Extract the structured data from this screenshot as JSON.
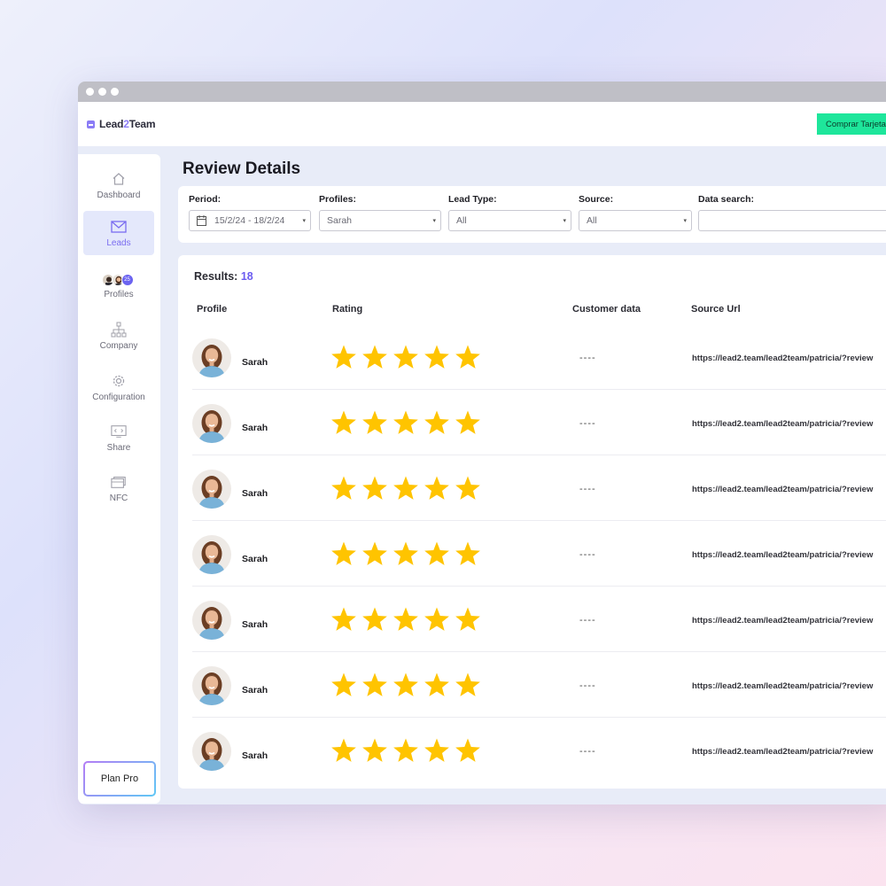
{
  "app": {
    "logo_prefix": "Lead",
    "logo_two": "2",
    "logo_suffix": "Team",
    "buy_button": "Comprar Tarjeta"
  },
  "sidebar": {
    "items": [
      {
        "label": "Dashboard",
        "icon": "home-icon"
      },
      {
        "label": "Leads",
        "icon": "mail-icon",
        "active": true
      },
      {
        "label": "Profiles",
        "icon": "profiles-avatars",
        "badge": "25"
      },
      {
        "label": "Company",
        "icon": "org-chart-icon"
      },
      {
        "label": "Configuration",
        "icon": "gear-icon"
      },
      {
        "label": "Share",
        "icon": "code-window-icon"
      },
      {
        "label": "NFC",
        "icon": "cards-icon"
      }
    ],
    "plan_button": "Plan Pro"
  },
  "page": {
    "title": "Review Details"
  },
  "filters": {
    "period": {
      "label": "Period:",
      "value": "15/2/24 - 18/2/24"
    },
    "profiles": {
      "label": "Profiles:",
      "value": "Sarah"
    },
    "lead_type": {
      "label": "Lead Type:",
      "value": "All"
    },
    "source": {
      "label": "Source:",
      "value": "All"
    },
    "data_search": {
      "label": "Data search:",
      "value": ""
    }
  },
  "results": {
    "label": "Results:",
    "count": "18",
    "columns": [
      "Profile",
      "Rating",
      "Customer data",
      "Source Url"
    ],
    "rows": [
      {
        "name": "Sarah",
        "rating": 5,
        "customer_data": "----",
        "source_url": "https://lead2.team/lead2team/patricia/?review"
      },
      {
        "name": "Sarah",
        "rating": 5,
        "customer_data": "----",
        "source_url": "https://lead2.team/lead2team/patricia/?review"
      },
      {
        "name": "Sarah",
        "rating": 5,
        "customer_data": "----",
        "source_url": "https://lead2.team/lead2team/patricia/?review"
      },
      {
        "name": "Sarah",
        "rating": 5,
        "customer_data": "----",
        "source_url": "https://lead2.team/lead2team/patricia/?review"
      },
      {
        "name": "Sarah",
        "rating": 5,
        "customer_data": "----",
        "source_url": "https://lead2.team/lead2team/patricia/?review"
      },
      {
        "name": "Sarah",
        "rating": 5,
        "customer_data": "----",
        "source_url": "https://lead2.team/lead2team/patricia/?review"
      },
      {
        "name": "Sarah",
        "rating": 5,
        "customer_data": "----",
        "source_url": "https://lead2.team/lead2team/patricia/?review"
      }
    ]
  },
  "colors": {
    "accent": "#7a6cf0",
    "star": "#ffc400",
    "buy_button": "#1ee69b"
  }
}
